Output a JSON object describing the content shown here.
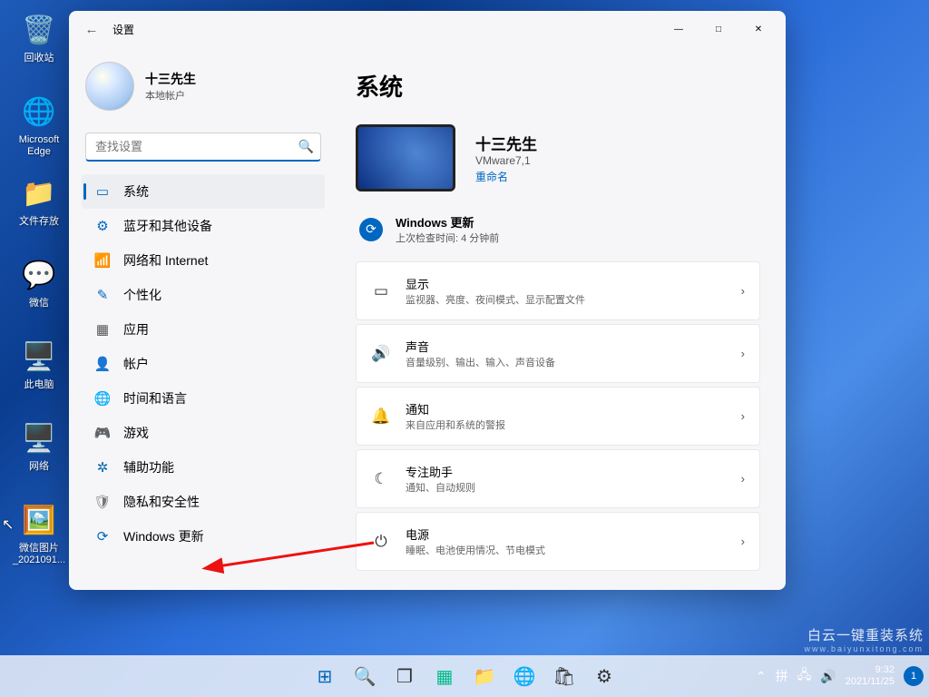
{
  "desktop_icons": [
    {
      "id": "recycle",
      "label": "回收站",
      "glyph": "🗑️",
      "color": "#fff"
    },
    {
      "id": "edge",
      "label": "Microsoft Edge",
      "glyph": "🌐",
      "color": "#39c"
    },
    {
      "id": "folder",
      "label": "文件存放",
      "glyph": "📁",
      "color": "#ffd36b"
    },
    {
      "id": "wechat",
      "label": "微信",
      "glyph": "💬",
      "color": "#1aad19"
    },
    {
      "id": "thispc",
      "label": "此电脑",
      "glyph": "🖥️",
      "color": "#4ab"
    },
    {
      "id": "network",
      "label": "网络",
      "glyph": "🖥️",
      "color": "#4ab"
    },
    {
      "id": "image",
      "label": "微信图片_2021091...",
      "glyph": "🖼️",
      "color": "#aaa"
    }
  ],
  "window": {
    "title": "设置",
    "user": {
      "name": "十三先生",
      "type": "本地帐户"
    },
    "search_placeholder": "查找设置",
    "nav": [
      {
        "id": "system",
        "label": "系统",
        "icon": "▭",
        "color": "#0067c0",
        "selected": true
      },
      {
        "id": "bluetooth",
        "label": "蓝牙和其他设备",
        "icon": "⚙",
        "color": "#0067c0"
      },
      {
        "id": "network",
        "label": "网络和 Internet",
        "icon": "📶",
        "color": "#0067c0"
      },
      {
        "id": "personalize",
        "label": "个性化",
        "icon": "✎",
        "color": "#0067c0"
      },
      {
        "id": "apps",
        "label": "应用",
        "icon": "▦",
        "color": "#555"
      },
      {
        "id": "accounts",
        "label": "帐户",
        "icon": "👤",
        "color": "#555"
      },
      {
        "id": "time",
        "label": "时间和语言",
        "icon": "🌐",
        "color": "#2aa"
      },
      {
        "id": "gaming",
        "label": "游戏",
        "icon": "🎮",
        "color": "#2aa"
      },
      {
        "id": "access",
        "label": "辅助功能",
        "icon": "✲",
        "color": "#06a"
      },
      {
        "id": "privacy",
        "label": "隐私和安全性",
        "icon": "🛡",
        "color": "#777"
      },
      {
        "id": "update",
        "label": "Windows 更新",
        "icon": "⟳",
        "color": "#0067c0"
      }
    ],
    "main": {
      "heading": "系统",
      "pc": {
        "name": "十三先生",
        "model": "VMware7,1",
        "rename": "重命名"
      },
      "update": {
        "title": "Windows 更新",
        "sub": "上次检查时间: 4 分钟前"
      },
      "cards": [
        {
          "id": "display",
          "icon": "▭",
          "title": "显示",
          "sub": "监视器、亮度、夜间模式、显示配置文件"
        },
        {
          "id": "sound",
          "icon": "🔊",
          "title": "声音",
          "sub": "音量级别、输出、输入、声音设备"
        },
        {
          "id": "notif",
          "icon": "🔔",
          "title": "通知",
          "sub": "来自应用和系统的警报"
        },
        {
          "id": "focus",
          "icon": "☾",
          "title": "专注助手",
          "sub": "通知、自动规则"
        },
        {
          "id": "power",
          "icon": "⏻",
          "title": "电源",
          "sub": "睡眠、电池使用情况、节电模式"
        }
      ]
    }
  },
  "taskbar": {
    "items": [
      {
        "id": "start",
        "glyph": "⊞",
        "color": "#0067c0"
      },
      {
        "id": "search",
        "glyph": "🔍",
        "color": "#333"
      },
      {
        "id": "taskview",
        "glyph": "❐",
        "color": "#333"
      },
      {
        "id": "widgets",
        "glyph": "▦",
        "color": "#0b8"
      },
      {
        "id": "explorer",
        "glyph": "📁",
        "color": "#ffd36b"
      },
      {
        "id": "edgeapp",
        "glyph": "🌐",
        "color": "#39c"
      },
      {
        "id": "store",
        "glyph": "🛍",
        "color": "#333"
      },
      {
        "id": "settingsapp",
        "glyph": "⚙",
        "color": "#333"
      }
    ],
    "tray": {
      "ime": "拼",
      "net": "🖧",
      "vol": "🔊",
      "time": "9:32",
      "date": "2021/11/25",
      "notif": "1"
    }
  },
  "watermark": {
    "line1": "白云一键重装系统",
    "line2": "www.baiyunxitong.com"
  }
}
